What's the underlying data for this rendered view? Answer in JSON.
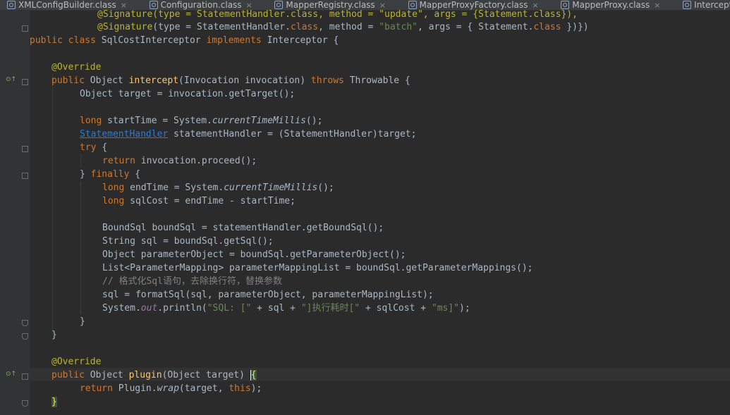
{
  "tabs": [
    {
      "label": "XMLConfigBuilder.class",
      "close": "×"
    },
    {
      "label": "Configuration.class",
      "close": "×"
    },
    {
      "label": "MapperRegistry.class",
      "close": "×"
    },
    {
      "label": "MapperProxyFactory.class",
      "close": "×"
    },
    {
      "label": "MapperProxy.class",
      "close": "×"
    },
    {
      "label": "InterceptorChain.class",
      "close": "×"
    }
  ],
  "code": {
    "l0": [
      "@Signature(type = StatementHandler.class, method = \"update\", args = {Statement.class}),"
    ],
    "l1": {
      "a": "@Signature",
      "b": "(type = StatementHandler.",
      "c": "class",
      "d": ", method = ",
      "e": "\"batch\"",
      "f": ", args = { Statement.",
      "g": "class",
      "h": " })})"
    },
    "l2": {
      "a": "public class ",
      "b": "SqlCostInterceptor ",
      "c": "implements ",
      "d": "Interceptor {"
    },
    "l4": "@Override",
    "l5": {
      "a": "public ",
      "b": "Object ",
      "c": "intercept",
      "d": "(Invocation invocation) ",
      "e": "throws ",
      "f": "Throwable {"
    },
    "l6": "Object target = invocation.getTarget();",
    "l8": {
      "a": "long ",
      "b": "startTime = System.",
      "c": "currentTimeMillis",
      "d": "();"
    },
    "l9": {
      "a": "StatementHandler",
      "b": " statementHandler = (StatementHandler)target;"
    },
    "l10": {
      "a": "try ",
      "b": "{"
    },
    "l11": {
      "a": "return ",
      "b": "invocation.proceed();"
    },
    "l12": {
      "a": "} ",
      "b": "finally ",
      "c": "{"
    },
    "l13": {
      "a": "long ",
      "b": "endTime = System.",
      "c": "currentTimeMillis",
      "d": "();"
    },
    "l14": {
      "a": "long ",
      "b": "sqlCost = endTime - startTime;"
    },
    "l16": "BoundSql boundSql = statementHandler.getBoundSql();",
    "l17": "String sql = boundSql.getSql();",
    "l18": "Object parameterObject = boundSql.getParameterObject();",
    "l19": "List<ParameterMapping> parameterMappingList = boundSql.getParameterMappings();",
    "l20": "// 格式化Sql语句，去除换行符，替换参数",
    "l21": "sql = formatSql(sql, parameterObject, parameterMappingList);",
    "l22": {
      "a": "System.",
      "b": "out",
      "c": ".println(",
      "d": "\"SQL: [\"",
      "e": " + sql + ",
      "f": "\"]执行耗时[\"",
      "g": " + sqlCost + ",
      "h": "\"ms]\"",
      "i": ");"
    },
    "l23": "}",
    "l24": "}",
    "l26": "@Override",
    "l27": {
      "a": "public ",
      "b": "Object ",
      "c": "plugin",
      "d": "(Object target) ",
      "e": "{"
    },
    "l28": {
      "a": "return ",
      "b": "Plugin.",
      "c": "wrap",
      "d": "(target, ",
      "e": "this",
      "f": ");"
    },
    "l29": "}"
  },
  "colors": {
    "background": "#2b2b2b",
    "gutter": "#313335",
    "keyword": "#cc7832",
    "annotation": "#bbb529",
    "string": "#6a8759",
    "method": "#ffc66d",
    "comment": "#808080",
    "link": "#287bde"
  },
  "gutter_icons": [
    "override-method-icon",
    "fold-icon"
  ]
}
